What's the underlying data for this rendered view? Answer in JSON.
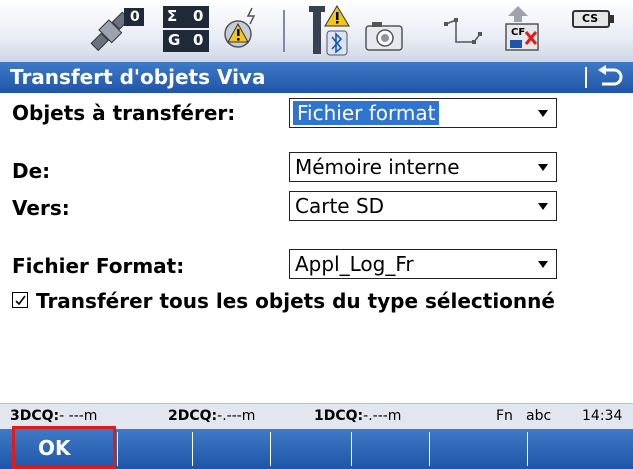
{
  "status_bar": {
    "satellite_count": "0",
    "sum_label": "Σ",
    "sum_value": "0",
    "g_label": "G",
    "g_value": "0",
    "sd_card_label": "CF",
    "cs_label": "CS"
  },
  "title_bar": {
    "title": "Transfert d'objets Viva"
  },
  "form": {
    "objects_label": "Objets à transférer:",
    "objects_value": "Fichier format",
    "from_label": "De:",
    "from_value": "Mémoire interne",
    "to_label": "Vers:",
    "to_value": "Carte SD",
    "format_label": "Fichier Format:",
    "format_value": "Appl_Log_Fr",
    "transfer_all_checked": true,
    "transfer_all_label": "Transférer tous les objets du type sélectionné"
  },
  "info_bar": {
    "q3d_label": "3DCQ:",
    "q3d_value": "- ---m",
    "q2d_label": "2DCQ:",
    "q2d_value": "-.---m",
    "q1d_label": "1DCQ:",
    "q1d_value": "-.---m",
    "fn": "Fn",
    "input_mode": "abc",
    "time": "14:34"
  },
  "softkeys": {
    "ok_label": "OK"
  },
  "colors": {
    "bar_blue": "#2a62b5",
    "highlight": "#2f74d0",
    "focus_red": "#e01b1b"
  }
}
